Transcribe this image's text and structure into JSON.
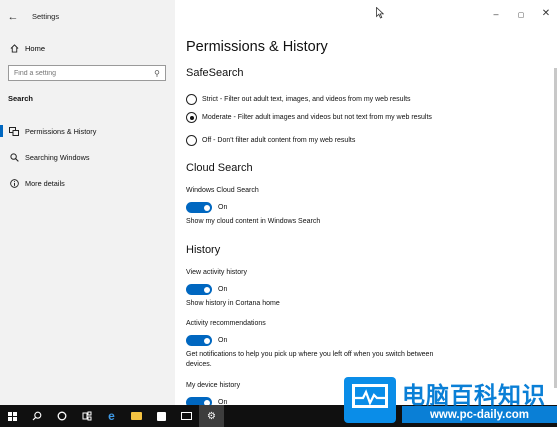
{
  "window": {
    "app_title": "Settings",
    "controls": {
      "minimize": "–",
      "maximize": "▢",
      "close": "✕"
    }
  },
  "sidebar": {
    "home_label": "Home",
    "search_placeholder": "Find a setting",
    "section_label": "Search",
    "items": [
      {
        "label": "Permissions & History",
        "icon": "permissions-icon",
        "active": true
      },
      {
        "label": "Searching Windows",
        "icon": "search-icon",
        "active": false
      },
      {
        "label": "More details",
        "icon": "info-icon",
        "active": false
      }
    ]
  },
  "main": {
    "page_title": "Permissions & History",
    "safesearch": {
      "heading": "SafeSearch",
      "options": [
        {
          "label": "Strict - Filter out adult text, images, and videos from my web results",
          "checked": false
        },
        {
          "label": "Moderate - Filter adult images and videos but not text from my web results",
          "checked": true
        },
        {
          "label": "Off - Don't filter adult content from my web results",
          "checked": false
        }
      ]
    },
    "cloud_search": {
      "heading": "Cloud Search",
      "windows_cloud_search": {
        "label": "Windows Cloud Search",
        "state": "On",
        "description": "Show my cloud content in Windows Search"
      }
    },
    "history": {
      "heading": "History",
      "view_activity": {
        "label": "View activity history",
        "state": "On",
        "description": "Show history in Cortana home"
      },
      "activity_recommendations": {
        "label": "Activity recommendations",
        "state": "On",
        "description": "Get notifications to help you pick up where you left off when you switch between devices."
      },
      "device_history": {
        "label": "My device history",
        "state": "On"
      }
    }
  },
  "taskbar": {
    "items": [
      "start-icon",
      "search-icon",
      "cortana-icon",
      "task-view-icon",
      "edge-icon",
      "file-explorer-icon",
      "store-icon",
      "mail-icon",
      "settings-icon"
    ]
  },
  "watermark": {
    "brand": "电脑百科知识",
    "url": "www.pc-daily.com"
  },
  "colors": {
    "accent": "#0067c0",
    "sidebar_bg": "#f2f2f2",
    "taskbar_bg": "#101010",
    "watermark_blue": "#0a7fd6"
  }
}
